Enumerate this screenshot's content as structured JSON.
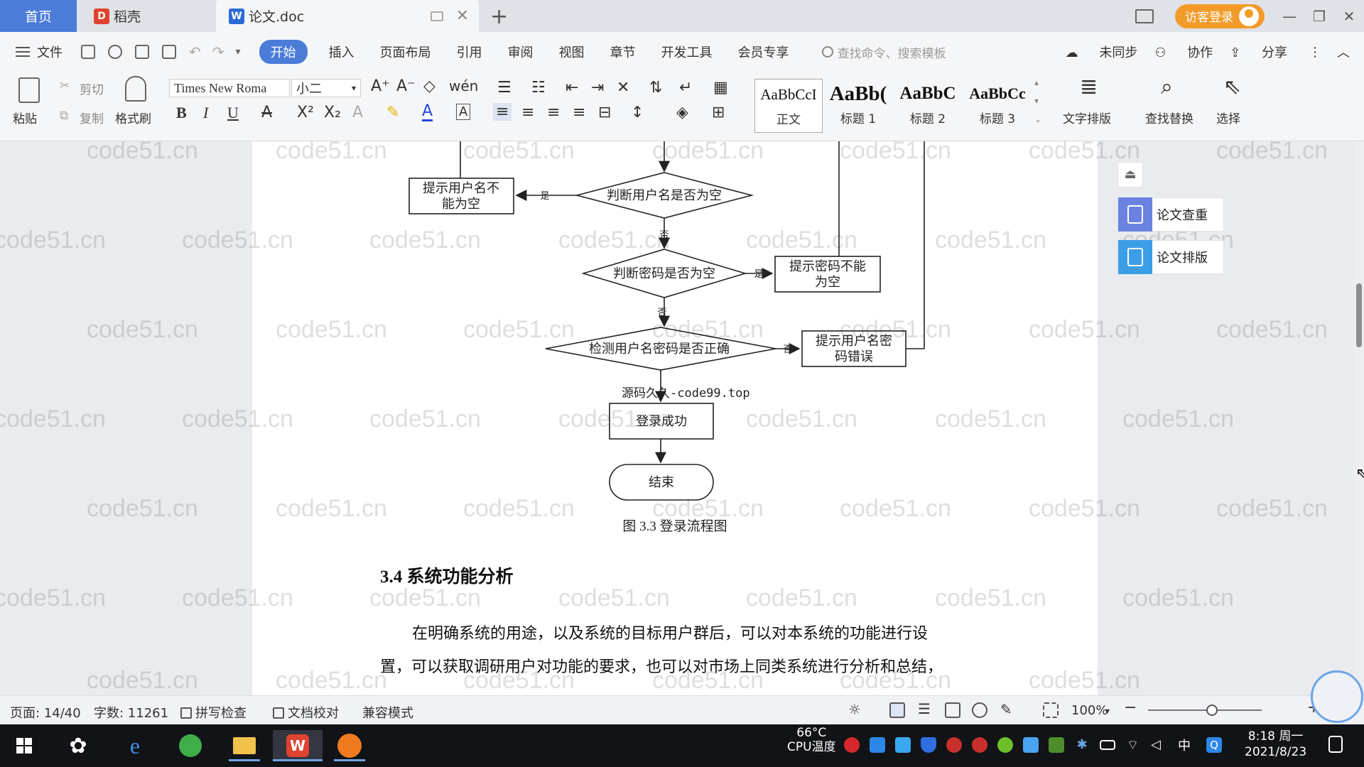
{
  "tabs": {
    "home": "首页",
    "daoke": "稻壳",
    "doc": "论文.doc"
  },
  "titlebar": {
    "guest_login": "访客登录"
  },
  "menu": {
    "file": "文件",
    "items": [
      "开始",
      "插入",
      "页面布局",
      "引用",
      "审阅",
      "视图",
      "章节",
      "开发工具",
      "会员专享"
    ],
    "search_placeholder": "查找命令、搜索模板",
    "sync": "未同步",
    "collab": "协作",
    "share": "分享"
  },
  "ribbon": {
    "paste": "粘贴",
    "cut": "剪切",
    "copy": "复制",
    "format_painter": "格式刷",
    "font_name": "Times New Roma",
    "font_size": "小二",
    "styles": [
      {
        "preview": "AaBbCcI",
        "name": "正文"
      },
      {
        "preview": "AaBb(",
        "name": "标题 1"
      },
      {
        "preview": "AaBbC",
        "name": "标题 2"
      },
      {
        "preview": "AaBbCc",
        "name": "标题 3"
      }
    ],
    "text_layout": "文字排版",
    "find_replace": "查找替换",
    "select": "选择"
  },
  "side_panel": {
    "check": "论文查重",
    "layout": "论文排版",
    "check_color": "#6a83e0",
    "layout_color": "#3d9ee8"
  },
  "document": {
    "flowchart": {
      "hint_username_empty": [
        "提示用户名不",
        "能为空"
      ],
      "check_username": "判断用户名是否为空",
      "check_password": "判断密码是否为空",
      "hint_password_empty": [
        "提示密码不能",
        "为空"
      ],
      "verify_credentials": "检测用户名密码是否正确",
      "hint_credentials_wrong": [
        "提示用户名密",
        "码错误"
      ],
      "login_success": "登录成功",
      "end": "结束",
      "yes": "是",
      "no": "否"
    },
    "source_mark": "源码久久-code99.top",
    "caption": "图 3.3  登录流程图",
    "section_title": "3.4 系统功能分析",
    "paragraph_lines": [
      "在明确系统的用途，以及系统的目标用户群后，可以对本系统的功能进行设",
      "置，可以获取调研用户对功能的要求，也可以对市场上同类系统进行分析和总结，"
    ],
    "watermark": "code51.cn"
  },
  "statusbar": {
    "page": "页面: 14/40",
    "words": "字数: 11261",
    "spell_check": "拼写检查",
    "doc_proof": "文档校对",
    "compat_mode": "兼容模式",
    "zoom": "100%",
    "zoom_fraction": 0.56
  },
  "taskbar": {
    "cpu_temp": "66°C",
    "cpu_label": "CPU温度",
    "ime": "中",
    "time": "8:18 周一",
    "date": "2021/8/23"
  }
}
